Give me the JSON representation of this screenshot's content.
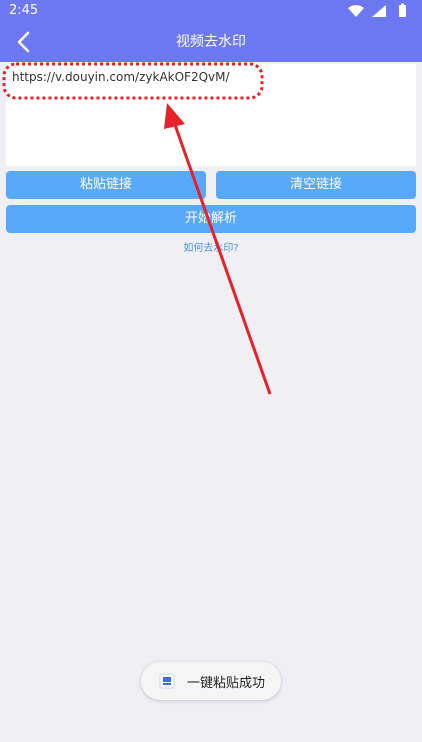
{
  "status_bar": {
    "time": "2:45",
    "icons": [
      "wifi-icon",
      "signal-icon",
      "battery-icon"
    ]
  },
  "app_bar": {
    "back_icon": "back-arrow-icon",
    "title": "视频去水印"
  },
  "link_input": {
    "value": "https://v.douyin.com/zykAkOF2QvM/"
  },
  "buttons": {
    "paste_label": "粘贴链接",
    "clear_label": "清空链接",
    "parse_label": "开始解析"
  },
  "help_link": "如何去水印?",
  "toast": {
    "icon": "app-icon",
    "message": "一键粘贴成功"
  },
  "colors": {
    "primary": "#6b78f2",
    "button": "#58a9f9",
    "background": "#efeff4",
    "annotation": "#e8202a"
  }
}
